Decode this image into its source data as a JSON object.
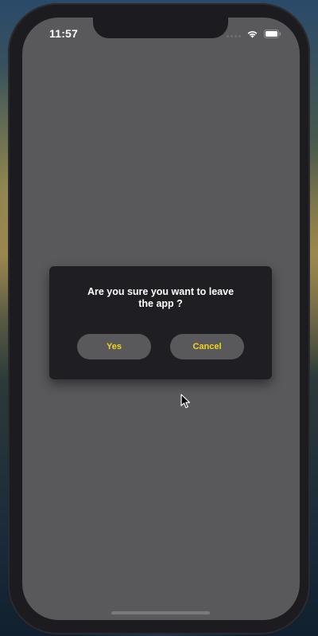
{
  "status_bar": {
    "time": "11:57",
    "icons": [
      "signal-icon",
      "wifi-icon",
      "battery-icon"
    ]
  },
  "dialog": {
    "message": "Are you sure you want to leave the app ?",
    "yes_label": "Yes",
    "cancel_label": "Cancel"
  },
  "colors": {
    "screen_background": "#59585a",
    "dialog_background": "#1f1e22",
    "button_text": "#f5d21f",
    "message_text": "#ffffff"
  }
}
